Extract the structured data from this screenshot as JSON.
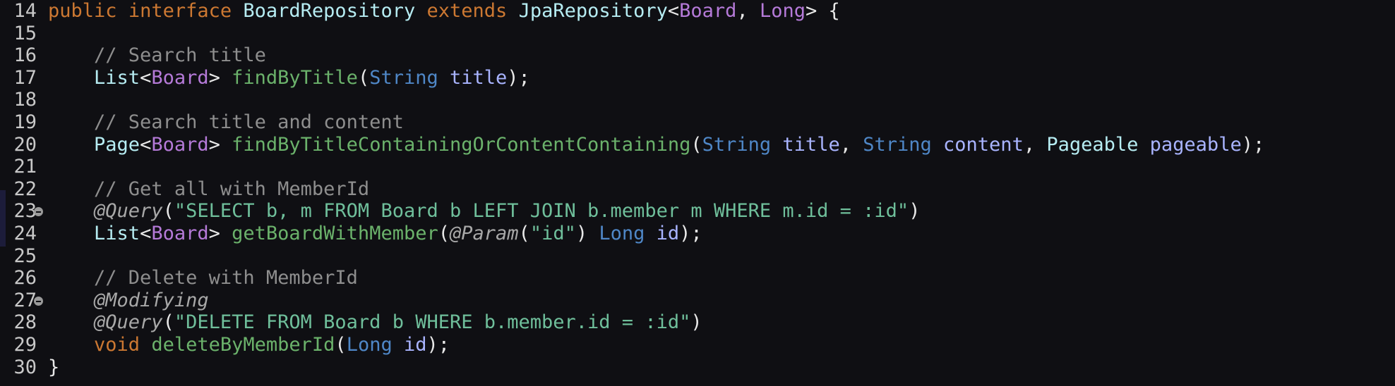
{
  "editor": {
    "lines": [
      {
        "num": "14",
        "tokens": [
          {
            "t": "public",
            "c": "kw"
          },
          {
            "t": " ",
            "c": "punc"
          },
          {
            "t": "interface",
            "c": "kw"
          },
          {
            "t": " ",
            "c": "punc"
          },
          {
            "t": "BoardRepository",
            "c": "type"
          },
          {
            "t": " ",
            "c": "punc"
          },
          {
            "t": "extends",
            "c": "kw"
          },
          {
            "t": " ",
            "c": "punc"
          },
          {
            "t": "JpaRepository",
            "c": "type"
          },
          {
            "t": "<",
            "c": "punc"
          },
          {
            "t": "Board",
            "c": "gen"
          },
          {
            "t": ", ",
            "c": "punc"
          },
          {
            "t": "Long",
            "c": "gen"
          },
          {
            "t": "> {",
            "c": "punc"
          }
        ]
      },
      {
        "num": "15",
        "tokens": []
      },
      {
        "num": "16",
        "tokens": [
          {
            "t": "    ",
            "c": "punc"
          },
          {
            "t": "// Search title",
            "c": "cmt"
          }
        ]
      },
      {
        "num": "17",
        "tokens": [
          {
            "t": "    ",
            "c": "punc"
          },
          {
            "t": "List",
            "c": "type"
          },
          {
            "t": "<",
            "c": "punc"
          },
          {
            "t": "Board",
            "c": "gen"
          },
          {
            "t": "> ",
            "c": "punc"
          },
          {
            "t": "findByTitle",
            "c": "fn"
          },
          {
            "t": "(",
            "c": "punc"
          },
          {
            "t": "String",
            "c": "ptype"
          },
          {
            "t": " ",
            "c": "punc"
          },
          {
            "t": "title",
            "c": "param"
          },
          {
            "t": ");",
            "c": "punc"
          }
        ]
      },
      {
        "num": "18",
        "tokens": []
      },
      {
        "num": "19",
        "tokens": [
          {
            "t": "    ",
            "c": "punc"
          },
          {
            "t": "// Search title and content",
            "c": "cmt"
          }
        ]
      },
      {
        "num": "20",
        "tokens": [
          {
            "t": "    ",
            "c": "punc"
          },
          {
            "t": "Page",
            "c": "type"
          },
          {
            "t": "<",
            "c": "punc"
          },
          {
            "t": "Board",
            "c": "gen"
          },
          {
            "t": "> ",
            "c": "punc"
          },
          {
            "t": "findByTitleContainingOrContentContaining",
            "c": "fn"
          },
          {
            "t": "(",
            "c": "punc"
          },
          {
            "t": "String",
            "c": "ptype"
          },
          {
            "t": " ",
            "c": "punc"
          },
          {
            "t": "title",
            "c": "param"
          },
          {
            "t": ", ",
            "c": "punc"
          },
          {
            "t": "String",
            "c": "ptype"
          },
          {
            "t": " ",
            "c": "punc"
          },
          {
            "t": "content",
            "c": "param"
          },
          {
            "t": ", ",
            "c": "punc"
          },
          {
            "t": "Pageable",
            "c": "type"
          },
          {
            "t": " ",
            "c": "punc"
          },
          {
            "t": "pageable",
            "c": "param"
          },
          {
            "t": ");",
            "c": "punc"
          }
        ]
      },
      {
        "num": "21",
        "tokens": []
      },
      {
        "num": "22",
        "tokens": [
          {
            "t": "    ",
            "c": "punc"
          },
          {
            "t": "// Get all with MemberId",
            "c": "cmt"
          }
        ]
      },
      {
        "num": "23",
        "fold": true,
        "tokens": [
          {
            "t": "    ",
            "c": "punc"
          },
          {
            "t": "@Query",
            "c": "anno"
          },
          {
            "t": "(",
            "c": "punc"
          },
          {
            "t": "\"SELECT b, m FROM Board b LEFT JOIN b.member m WHERE m.id = :id\"",
            "c": "str"
          },
          {
            "t": ")",
            "c": "punc"
          }
        ]
      },
      {
        "num": "24",
        "tokens": [
          {
            "t": "    ",
            "c": "punc"
          },
          {
            "t": "List",
            "c": "type"
          },
          {
            "t": "<",
            "c": "punc"
          },
          {
            "t": "Board",
            "c": "gen"
          },
          {
            "t": "> ",
            "c": "punc"
          },
          {
            "t": "getBoardWithMember",
            "c": "fn"
          },
          {
            "t": "(",
            "c": "punc"
          },
          {
            "t": "@Param",
            "c": "anno"
          },
          {
            "t": "(",
            "c": "punc"
          },
          {
            "t": "\"id\"",
            "c": "str"
          },
          {
            "t": ") ",
            "c": "punc"
          },
          {
            "t": "Long",
            "c": "ptype"
          },
          {
            "t": " ",
            "c": "punc"
          },
          {
            "t": "id",
            "c": "param"
          },
          {
            "t": ");",
            "c": "punc"
          }
        ]
      },
      {
        "num": "25",
        "tokens": []
      },
      {
        "num": "26",
        "tokens": [
          {
            "t": "    ",
            "c": "punc"
          },
          {
            "t": "// Delete with MemberId",
            "c": "cmt"
          }
        ]
      },
      {
        "num": "27",
        "fold": true,
        "tokens": [
          {
            "t": "    ",
            "c": "punc"
          },
          {
            "t": "@Modifying",
            "c": "anno"
          }
        ]
      },
      {
        "num": "28",
        "tokens": [
          {
            "t": "    ",
            "c": "punc"
          },
          {
            "t": "@Query",
            "c": "anno"
          },
          {
            "t": "(",
            "c": "punc"
          },
          {
            "t": "\"DELETE FROM Board b WHERE b.member.id = :id\"",
            "c": "str"
          },
          {
            "t": ")",
            "c": "punc"
          }
        ]
      },
      {
        "num": "29",
        "tokens": [
          {
            "t": "    ",
            "c": "punc"
          },
          {
            "t": "void",
            "c": "kw"
          },
          {
            "t": " ",
            "c": "punc"
          },
          {
            "t": "deleteByMemberId",
            "c": "fn"
          },
          {
            "t": "(",
            "c": "punc"
          },
          {
            "t": "Long",
            "c": "ptype"
          },
          {
            "t": " ",
            "c": "punc"
          },
          {
            "t": "id",
            "c": "param"
          },
          {
            "t": ");",
            "c": "punc"
          }
        ]
      },
      {
        "num": "30",
        "tokens": [
          {
            "t": "}",
            "c": "punc"
          }
        ]
      }
    ]
  }
}
